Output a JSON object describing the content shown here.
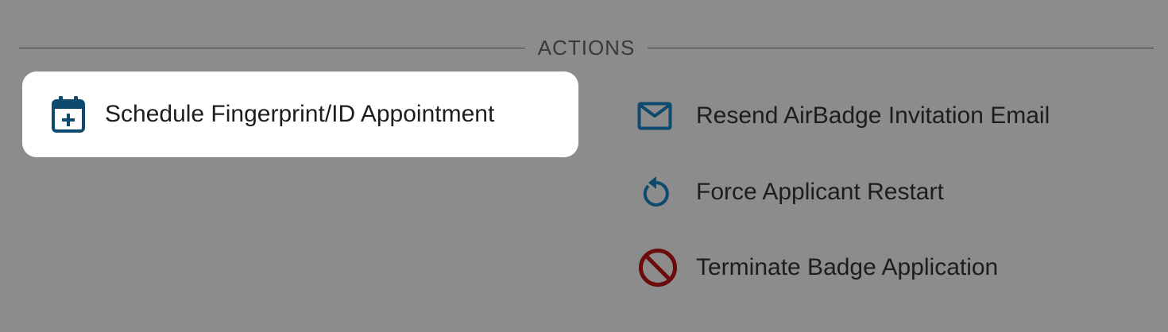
{
  "section": {
    "title": "ACTIONS"
  },
  "actions": [
    {
      "label": "Schedule Fingerprint/ID Appointment",
      "icon": "calendar-plus-icon",
      "highlighted": true
    },
    {
      "label": "Resend AirBadge Invitation Email",
      "icon": "mail-icon"
    },
    {
      "label": "Force Applicant Restart",
      "icon": "restart-icon"
    },
    {
      "label": "Terminate Badge Application",
      "icon": "block-icon"
    }
  ],
  "colors": {
    "background": "#8c8c8c",
    "primary_icon": "#0d4a6e",
    "danger_icon": "#6b0b0b",
    "highlight_bg": "#ffffff"
  }
}
